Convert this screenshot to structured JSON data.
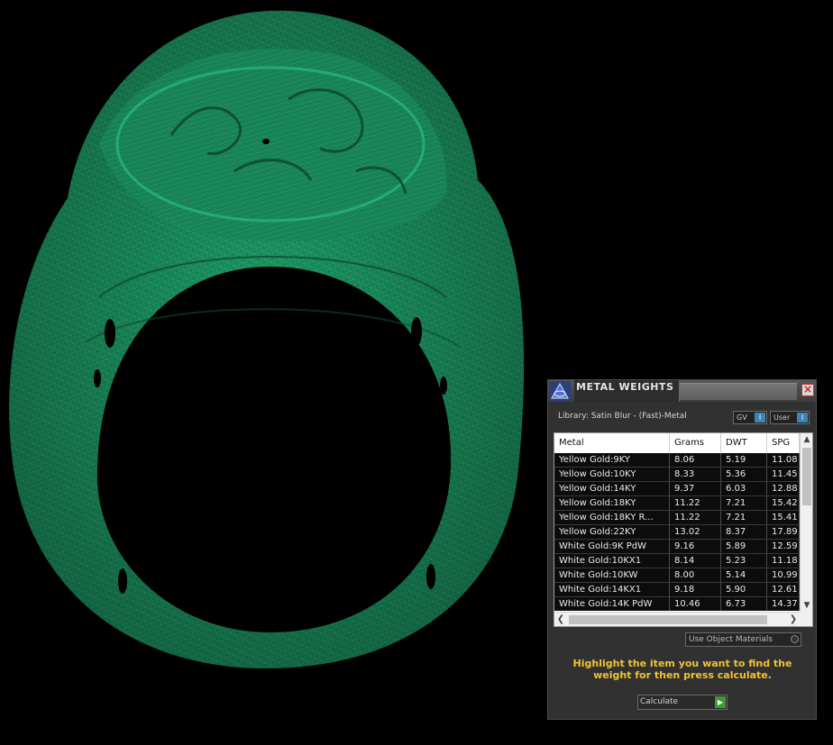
{
  "panel": {
    "title": "METAL WEIGHTS",
    "close_label": "×",
    "library": "Library: Satin Blur - (Fast)-Metal",
    "toggles": [
      {
        "label": "GV",
        "knob": "I"
      },
      {
        "label": "User",
        "knob": "I"
      }
    ],
    "table": {
      "headers": [
        "Metal",
        "Grams",
        "DWT",
        "SPG"
      ],
      "rows": [
        [
          "Yellow Gold:9KY",
          "8.06",
          "5.19",
          "11.08"
        ],
        [
          "Yellow Gold:10KY",
          "8.33",
          "5.36",
          "11.45"
        ],
        [
          "Yellow Gold:14KY",
          "9.37",
          "6.03",
          "12.88"
        ],
        [
          "Yellow Gold:18KY",
          "11.22",
          "7.21",
          "15.42"
        ],
        [
          "Yellow Gold:18KY R...",
          "11.22",
          "7.21",
          "15.41"
        ],
        [
          "Yellow Gold:22KY",
          "13.02",
          "8.37",
          "17.89"
        ],
        [
          "White Gold:9K PdW",
          "9.16",
          "5.89",
          "12.59"
        ],
        [
          "White Gold:10KX1",
          "8.14",
          "5.23",
          "11.18"
        ],
        [
          "White Gold:10KW",
          "8.00",
          "5.14",
          "10.99"
        ],
        [
          "White Gold:14KX1",
          "9.18",
          "5.90",
          "12.61"
        ],
        [
          "White Gold:14K PdW",
          "10.46",
          "6.73",
          "14.37"
        ]
      ]
    },
    "use_object_materials": "Use Object Materials",
    "hint": "Highlight the item you want to find the weight for then press calculate.",
    "calculate_label": "Calculate",
    "colors": {
      "accent_hint": "#f1c232",
      "wireframe": "#1f9a66"
    }
  }
}
